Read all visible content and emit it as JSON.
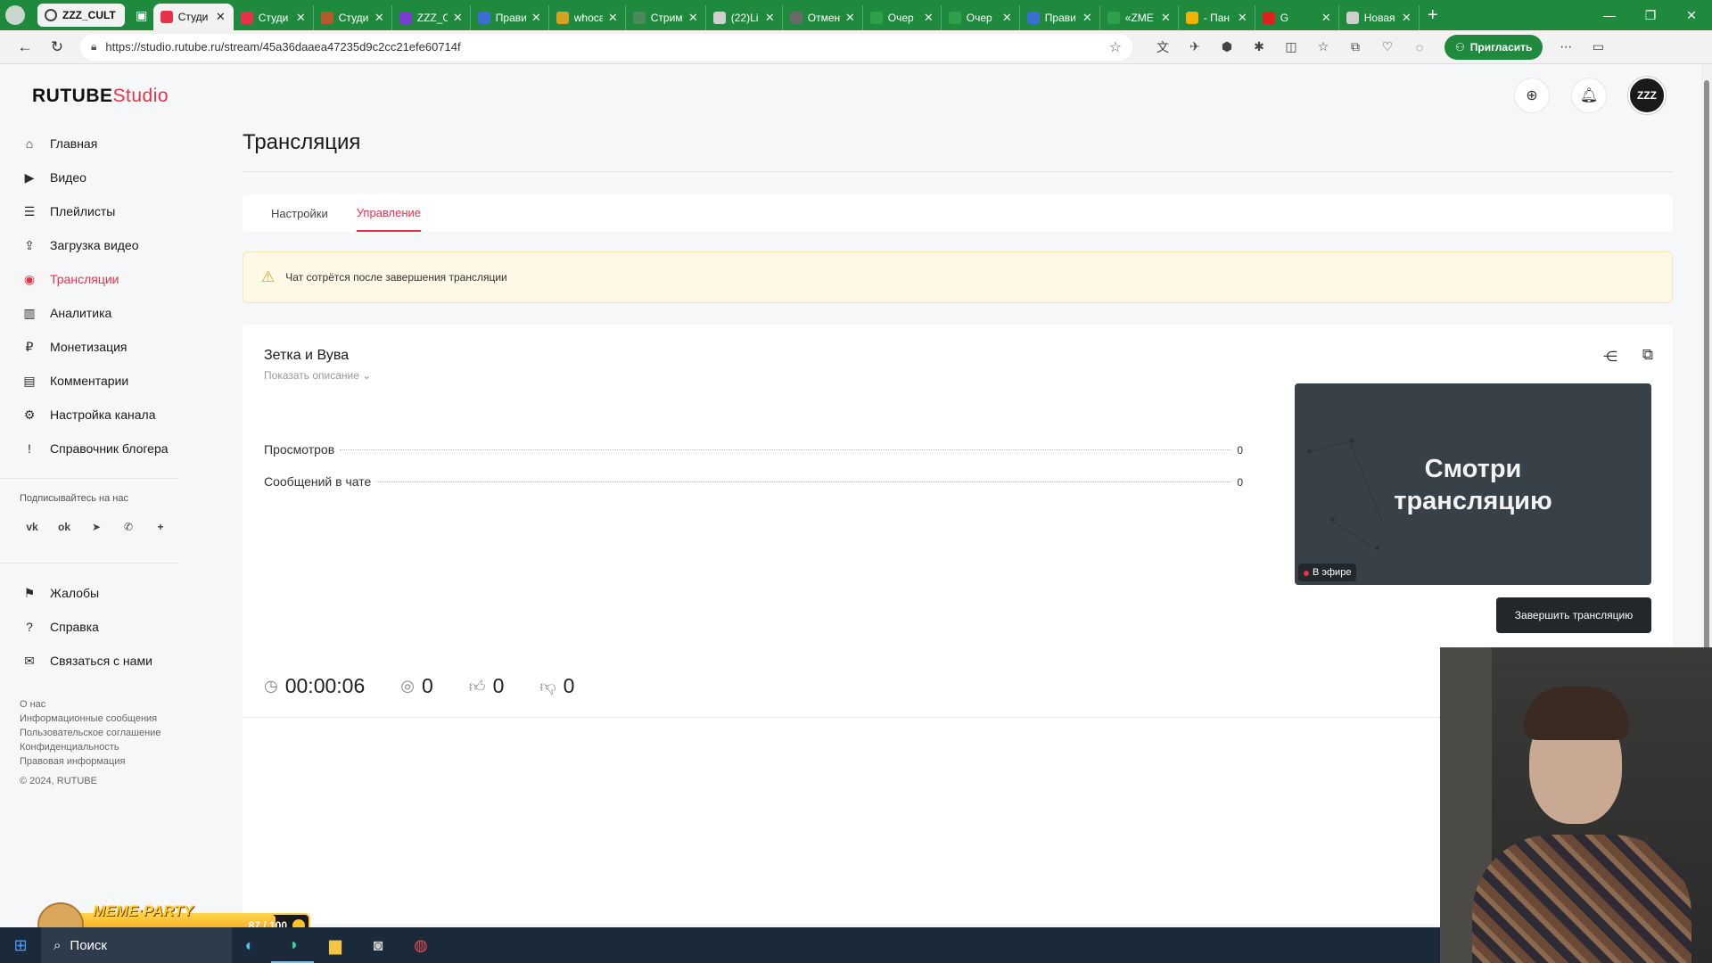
{
  "browser": {
    "group_label": "ZZZ_CULT",
    "tabs": [
      {
        "title": "Студи",
        "color": "#e8324b"
      },
      {
        "title": "Студи",
        "color": "#e8324b"
      },
      {
        "title": "Студи",
        "color": "#b45b2a"
      },
      {
        "title": "ZZZ_C",
        "color": "#7a3fd1"
      },
      {
        "title": "Прави",
        "color": "#3b6fd4"
      },
      {
        "title": "whoca",
        "color": "#d6a022"
      },
      {
        "title": "Стрим",
        "color": "#4a8a5a"
      },
      {
        "title": "(22)Li",
        "color": "#cfcfcf"
      },
      {
        "title": "Отмен",
        "color": "#6a6a6a"
      },
      {
        "title": "Очер",
        "color": "#2ea04a"
      },
      {
        "title": "Очер",
        "color": "#2ea04a"
      },
      {
        "title": "Прави",
        "color": "#3b6fd4"
      },
      {
        "title": "«ZME",
        "color": "#2ea04a"
      },
      {
        "title": "- Пан",
        "color": "#f0b400"
      },
      {
        "title": "G",
        "color": "#e02020"
      },
      {
        "title": "Новая",
        "color": "#cfcfcf"
      }
    ],
    "url": "https://studio.rutube.ru/stream/45a36daaea47235d9c2cc21efe60714f",
    "invite_label": "Пригласить"
  },
  "logo": {
    "brand": "RUTUBE",
    "product": "Studio"
  },
  "sidebar": {
    "items": [
      {
        "label": "Главная",
        "icon": "home-icon",
        "glyph": "⌂"
      },
      {
        "label": "Видео",
        "icon": "video-icon",
        "glyph": "▶"
      },
      {
        "label": "Плейлисты",
        "icon": "playlist-icon",
        "glyph": "☰"
      },
      {
        "label": "Загрузка видео",
        "icon": "upload-icon",
        "glyph": "⇪"
      },
      {
        "label": "Трансляции",
        "icon": "broadcast-icon",
        "glyph": "◉",
        "active": true
      },
      {
        "label": "Аналитика",
        "icon": "analytics-icon",
        "glyph": "▥"
      },
      {
        "label": "Монетизация",
        "icon": "monetization-icon",
        "glyph": "₽"
      },
      {
        "label": "Комментарии",
        "icon": "comments-icon",
        "glyph": "▤"
      },
      {
        "label": "Настройка канала",
        "icon": "settings-icon",
        "glyph": "⚙"
      },
      {
        "label": "Справочник блогера",
        "icon": "guide-icon",
        "glyph": "!"
      }
    ],
    "subscribe_label": "Подписывайтесь на нас",
    "socials": [
      {
        "name": "vk-icon",
        "glyph": "vk"
      },
      {
        "name": "ok-icon",
        "glyph": "ok"
      },
      {
        "name": "telegram-icon",
        "glyph": "➤"
      },
      {
        "name": "viber-icon",
        "glyph": "✆"
      },
      {
        "name": "more-icon",
        "glyph": "+"
      }
    ],
    "bottom_items": [
      {
        "label": "Жалобы",
        "icon": "flag-icon",
        "glyph": "⚑"
      },
      {
        "label": "Справка",
        "icon": "help-icon",
        "glyph": "?"
      },
      {
        "label": "Связаться с нами",
        "icon": "mail-icon",
        "glyph": "✉"
      }
    ],
    "footer_links": [
      "О нас",
      "Информационные сообщения",
      "Пользовательское соглашение",
      "Конфиденциальность",
      "Правовая информация"
    ],
    "copyright": "© 2024, RUTUBE"
  },
  "page": {
    "title": "Трансляция",
    "tabs": [
      {
        "label": "Настройки",
        "active": false
      },
      {
        "label": "Управление",
        "active": true
      }
    ],
    "notice": "Чат сотрётся после завершения трансляции"
  },
  "stream": {
    "title": "Зетка и Вува",
    "show_description": "Показать описание",
    "stats": [
      {
        "label": "Просмотров",
        "value": "0"
      },
      {
        "label": "Сообщений в чате",
        "value": "0"
      }
    ],
    "preview_text_line1": "Смотри",
    "preview_text_line2": "трансляцию",
    "live_badge": "В эфире",
    "end_button": "Завершить трансляцию",
    "duration": "00:00:06",
    "viewers": "0",
    "likes": "0",
    "dislikes": "0"
  },
  "overlay": {
    "meme_label": "MEME·PARTY",
    "meme_count": "87 / 100",
    "meme_progress": 0.87
  },
  "taskbar": {
    "search_label": "Поиск"
  },
  "colors": {
    "accent": "#e8324b",
    "browser_frame": "#1f8a3e",
    "notice_bg": "#fff8e6"
  }
}
